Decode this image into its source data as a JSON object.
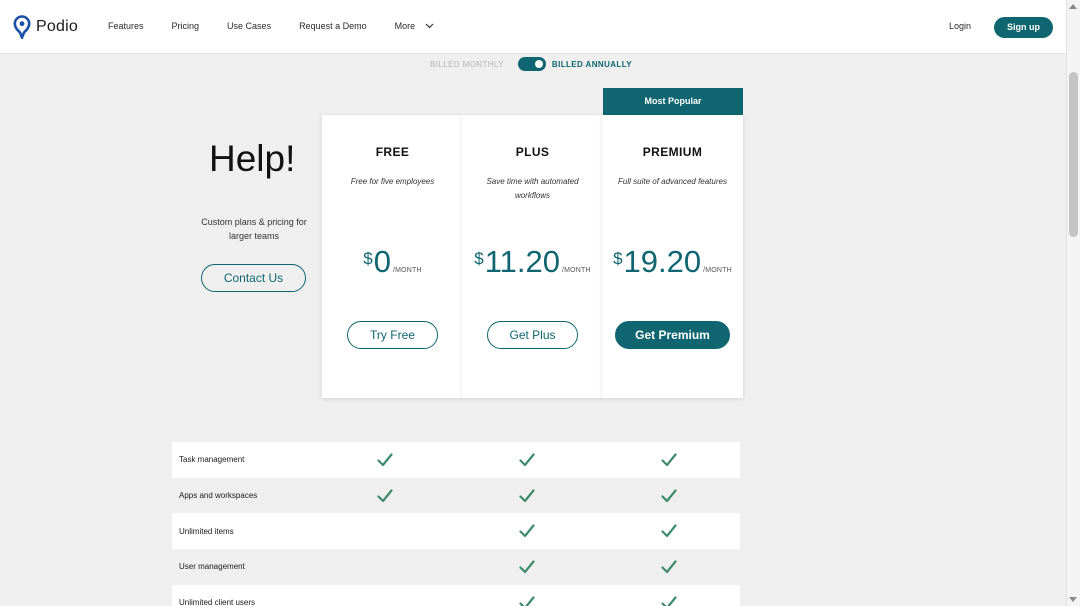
{
  "header": {
    "logo_text": "Podio",
    "nav": [
      {
        "label": "Features"
      },
      {
        "label": "Pricing"
      },
      {
        "label": "Use Cases"
      },
      {
        "label": "Request a Demo"
      },
      {
        "label": "More"
      }
    ],
    "login": "Login",
    "signup": "Sign up"
  },
  "billing": {
    "monthly": "BILLED MONTHLY",
    "annually": "BILLED ANNUALLY",
    "annual_selected": true
  },
  "help": {
    "title": "Help!",
    "subtitle": "Custom plans & pricing for larger teams",
    "contact_button": "Contact Us"
  },
  "badge": "Most Popular",
  "plans": [
    {
      "name": "FREE",
      "description": "Free for five employees",
      "currency": "$",
      "amount": "0",
      "period": "/MONTH",
      "button": "Try Free"
    },
    {
      "name": "PLUS",
      "description": "Save time with automated workflows",
      "currency": "$",
      "amount": "11.20",
      "period": "/MONTH",
      "button": "Get Plus"
    },
    {
      "name": "PREMIUM",
      "description": "Full suite of advanced features",
      "currency": "$",
      "amount": "19.20",
      "period": "/MONTH",
      "button": "Get Premium"
    }
  ],
  "features": [
    {
      "name": "Task management",
      "free": true,
      "plus": true,
      "premium": true
    },
    {
      "name": "Apps and workspaces",
      "free": true,
      "plus": true,
      "premium": true
    },
    {
      "name": "Unlimited items",
      "free": false,
      "plus": true,
      "premium": true
    },
    {
      "name": "User management",
      "free": false,
      "plus": true,
      "premium": true
    },
    {
      "name": "Unlimited client users",
      "free": false,
      "plus": true,
      "premium": true
    }
  ],
  "colors": {
    "accent": "#0f6670",
    "check": "#3f8a6c",
    "background": "#eeefee"
  }
}
